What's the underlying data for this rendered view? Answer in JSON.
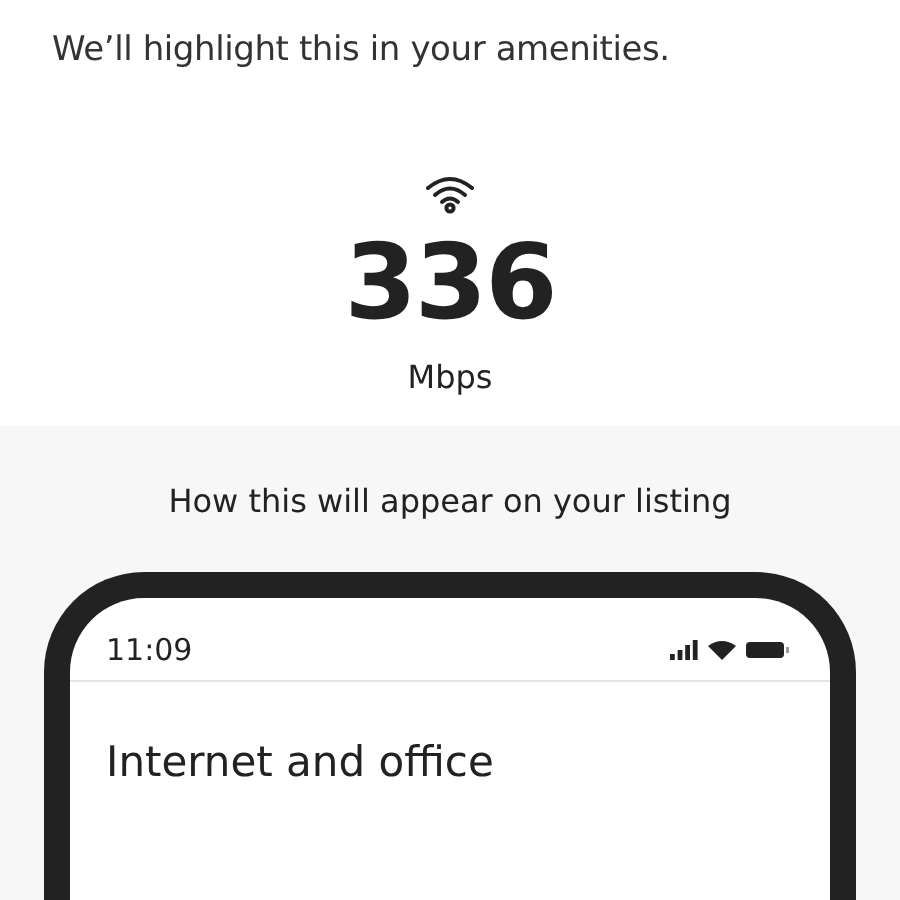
{
  "header": {
    "subtitle": "We’ll highlight this in your amenities."
  },
  "result": {
    "speed": "336",
    "unit": "Mbps"
  },
  "preview": {
    "caption": "How this will appear on your listing",
    "phone": {
      "time": "11:09",
      "section_title": "Internet and office"
    }
  }
}
